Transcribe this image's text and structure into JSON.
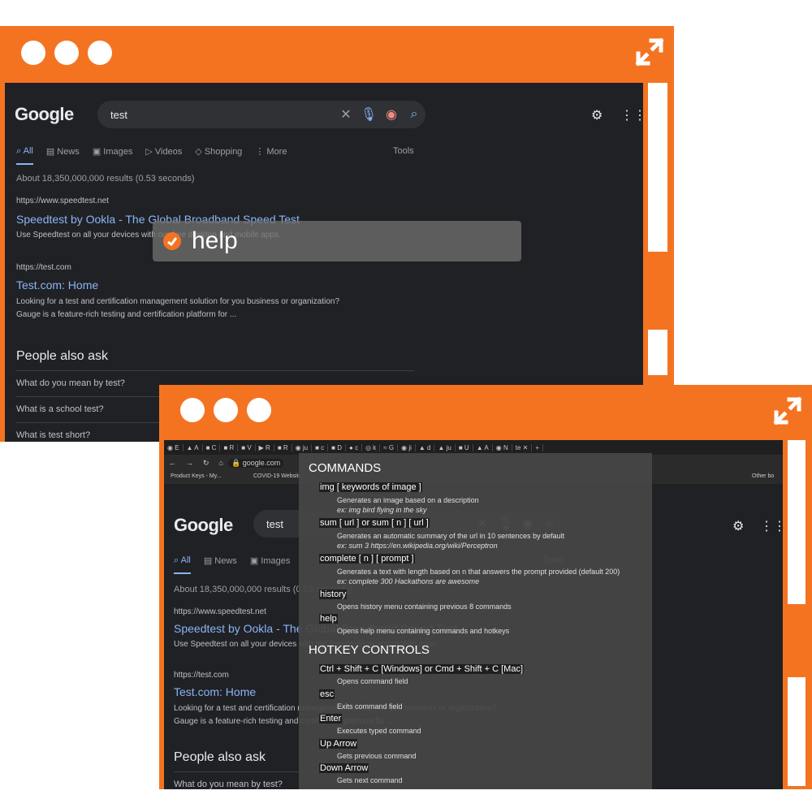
{
  "back_window": {
    "search_query": "test",
    "tabs": [
      "All",
      "News",
      "Images",
      "Videos",
      "Shopping",
      "More"
    ],
    "tools_label": "Tools",
    "stats": "About 18,350,000,000 results (0.53 seconds)",
    "results": [
      {
        "url": "https://www.speedtest.net",
        "title": "Speedtest by Ookla - The Global Broadband Speed Test",
        "snippet": "Use Speedtest on all your devices with our free desktop and mobile apps."
      },
      {
        "url": "https://test.com",
        "title": "Test.com: Home",
        "snippet1": "Looking for a test and certification management solution for you business or organization?",
        "snippet2": "Gauge is a feature-rich testing and certification platform for ..."
      }
    ],
    "paa_heading": "People also ask",
    "paa_questions": [
      "What do you mean by test?",
      "What is a school test?",
      "What is test short?"
    ],
    "command_input": "help"
  },
  "front_window": {
    "address": "google.com",
    "bookmarks": [
      "Product Keys - My...",
      "COVID-19 Website",
      "Other bo"
    ],
    "help_panel": {
      "commands_heading": "COMMANDS",
      "commands": [
        {
          "cmd": "img [ keywords of image ]",
          "desc": "Generates an image based on a description",
          "ex": "ex: img bird flying in the sky"
        },
        {
          "cmd": "sum [ url ] or sum [ n ] [ url ]",
          "desc": "Generates an automatic summary of the url in 10 sentences by default",
          "ex": "ex: sum 3 https://en.wikipedia.org/wiki/Perceptron"
        },
        {
          "cmd": "complete [ n ] [ prompt ]",
          "desc": "Generates a text with length based on n that answers the prompt provided (default 200)",
          "ex": "ex: complete 300 Hackathons are awesome"
        },
        {
          "cmd": "history",
          "desc": "Opens history menu containing previous 8 commands",
          "ex": ""
        },
        {
          "cmd": "help",
          "desc": "Opens help menu containing commands and hotkeys",
          "ex": ""
        }
      ],
      "hotkey_heading": "HOTKEY CONTROLS",
      "hotkeys": [
        {
          "key": "Ctrl + Shift + C [Windows] or Cmd + Shift + C [Mac]",
          "desc": "Opens command field"
        },
        {
          "key": "esc",
          "desc": "Exits command field"
        },
        {
          "key": "Enter",
          "desc": "Executes typed command"
        },
        {
          "key": "Up Arrow",
          "desc": "Gets previous command"
        },
        {
          "key": "Down Arrow",
          "desc": "Gets next command"
        }
      ]
    }
  },
  "colors": {
    "frame": "#f47321",
    "page_bg": "#202124",
    "link": "#8ab4f8"
  }
}
